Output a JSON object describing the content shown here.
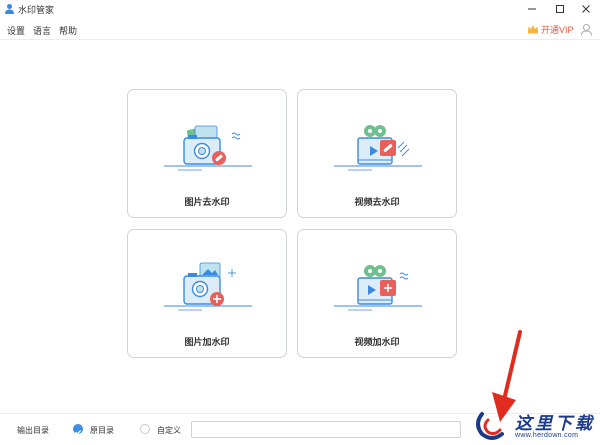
{
  "window": {
    "title": "水印管家"
  },
  "menu": {
    "items": [
      "设置",
      "语言",
      "帮助"
    ],
    "vip_label": "开通VIP"
  },
  "cards": [
    {
      "label": "图片去水印",
      "icon": "photo-remove-watermark-icon"
    },
    {
      "label": "视频去水印",
      "icon": "video-remove-watermark-icon"
    },
    {
      "label": "图片加水印",
      "icon": "photo-add-watermark-icon"
    },
    {
      "label": "视频加水印",
      "icon": "video-add-watermark-icon"
    }
  ],
  "output": {
    "label": "输出目录",
    "options": [
      {
        "label": "原目录",
        "checked": true
      },
      {
        "label": "自定义",
        "checked": false
      }
    ],
    "path_value": ""
  },
  "watermark": {
    "title": "这里下载",
    "url": "www.herdown.com"
  },
  "colors": {
    "accent": "#3a8fe6",
    "vip": "#e8553a",
    "illus_blue": "#3b8ae0",
    "illus_red": "#e8605a",
    "illus_green": "#6fbf8f"
  }
}
